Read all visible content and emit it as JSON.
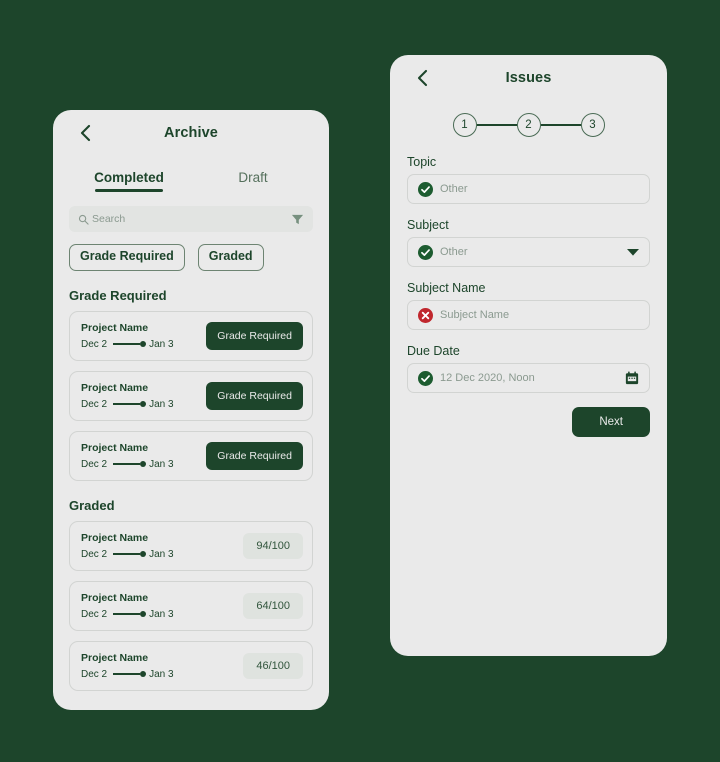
{
  "theme": {
    "page_background": "#1d452b",
    "panel_background": "#eaeaea",
    "primary": "#1d452b",
    "muted_text": "#8b9a90",
    "success": "#1d5c30",
    "error": "#c0272d",
    "score_pill_background": "#dfe3df"
  },
  "archive": {
    "title": "Archive",
    "back_icon": "chevron-left-icon",
    "tabs": [
      {
        "label": "Completed",
        "active": true
      },
      {
        "label": "Draft",
        "active": false
      }
    ],
    "search": {
      "placeholder": "Search",
      "icon": "search-icon",
      "filter_icon": "filter-funnel-icon"
    },
    "chips": [
      {
        "label": "Grade Required"
      },
      {
        "label": "Graded"
      }
    ],
    "sections": [
      {
        "title": "Grade Required",
        "items": [
          {
            "name": "Project Name",
            "start_date": "Dec 2",
            "end_date": "Jan 3",
            "action_label": "Grade Required"
          },
          {
            "name": "Project Name",
            "start_date": "Dec 2",
            "end_date": "Jan 3",
            "action_label": "Grade Required"
          },
          {
            "name": "Project Name",
            "start_date": "Dec 2",
            "end_date": "Jan 3",
            "action_label": "Grade Required"
          }
        ]
      },
      {
        "title": "Graded",
        "items": [
          {
            "name": "Project Name",
            "start_date": "Dec 2",
            "end_date": "Jan 3",
            "score": "94/100"
          },
          {
            "name": "Project Name",
            "start_date": "Dec 2",
            "end_date": "Jan 3",
            "score": "64/100"
          },
          {
            "name": "Project Name",
            "start_date": "Dec 2",
            "end_date": "Jan 3",
            "score": "46/100"
          }
        ]
      }
    ]
  },
  "issues": {
    "title": "Issues",
    "back_icon": "chevron-left-icon",
    "steps": [
      {
        "label": "1"
      },
      {
        "label": "2"
      },
      {
        "label": "3"
      }
    ],
    "fields": [
      {
        "label": "Topic",
        "value": "Other",
        "status": "valid",
        "status_icon": "check-circle-icon",
        "trailing_icon": null
      },
      {
        "label": "Subject",
        "value": "Other",
        "status": "valid",
        "status_icon": "check-circle-icon",
        "trailing_icon": "chevron-down-icon"
      },
      {
        "label": "Subject Name",
        "value": "Subject Name",
        "status": "error",
        "status_icon": "error-circle-icon",
        "trailing_icon": null
      },
      {
        "label": "Due Date",
        "value": "12 Dec 2020, Noon",
        "status": "valid",
        "status_icon": "check-circle-icon",
        "trailing_icon": "calendar-icon"
      }
    ],
    "next_label": "Next"
  }
}
